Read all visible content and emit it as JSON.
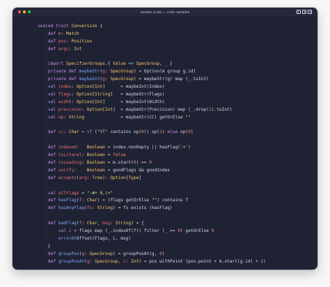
{
  "window": {
    "title": "sample.scala — code-samples"
  },
  "colors": {
    "background": "#1f2233",
    "keyword": "#c792ea",
    "type": "#ffcb6b",
    "function": "#82aaff",
    "variable": "#f07178",
    "operator": "#89ddff",
    "string": "#c3e88d",
    "number": "#f78c6c"
  },
  "icons": {
    "window_controls": [
      "close-dot-icon",
      "minimize-dot-icon",
      "zoom-dot-icon"
    ],
    "layout_tools": [
      "sidebar-layout-icon",
      "split-layout-icon",
      "right-panel-layout-icon"
    ]
  },
  "code": {
    "lines": [
      [
        {
          "t": "sealed ",
          "c": "k"
        },
        {
          "t": "trait ",
          "c": "k"
        },
        {
          "t": "Conversion",
          "c": "t"
        },
        {
          "t": " {",
          "c": "w"
        }
      ],
      [
        {
          "t": "    def ",
          "c": "k"
        },
        {
          "t": "m",
          "c": "v"
        },
        {
          "t": ": ",
          "c": "w"
        },
        {
          "t": "Match",
          "c": "t"
        }
      ],
      [
        {
          "t": "    def ",
          "c": "k"
        },
        {
          "t": "pos",
          "c": "v"
        },
        {
          "t": ": ",
          "c": "w"
        },
        {
          "t": "Position",
          "c": "t"
        }
      ],
      [
        {
          "t": "    def ",
          "c": "k"
        },
        {
          "t": "argc",
          "c": "v"
        },
        {
          "t": ": ",
          "c": "w"
        },
        {
          "t": "Int",
          "c": "t"
        }
      ],
      [
        {
          "t": "",
          "c": "w"
        }
      ],
      [
        {
          "t": "    import ",
          "c": "k"
        },
        {
          "t": "SpecifierGroups",
          "c": "t"
        },
        {
          "t": ".{ ",
          "c": "w"
        },
        {
          "t": "Value",
          "c": "t"
        },
        {
          "t": " => ",
          "c": "p"
        },
        {
          "t": "SpecGroup",
          "c": "t"
        },
        {
          "t": ", _ }",
          "c": "w"
        }
      ],
      [
        {
          "t": "    private ",
          "c": "k"
        },
        {
          "t": "def ",
          "c": "k"
        },
        {
          "t": "maybeStr",
          "c": "f"
        },
        {
          "t": "(",
          "c": "w"
        },
        {
          "t": "g",
          "c": "v"
        },
        {
          "t": ": ",
          "c": "w"
        },
        {
          "t": "SpecGroup",
          "c": "t"
        },
        {
          "t": ") = Option(m group g.id)",
          "c": "w"
        }
      ],
      [
        {
          "t": "    private ",
          "c": "k"
        },
        {
          "t": "def ",
          "c": "k"
        },
        {
          "t": "maybeInt",
          "c": "f"
        },
        {
          "t": "(",
          "c": "w"
        },
        {
          "t": "g",
          "c": "v"
        },
        {
          "t": ": ",
          "c": "w"
        },
        {
          "t": "SpecGroup",
          "c": "t"
        },
        {
          "t": ") = maybeStr(g) map (_.toInt)",
          "c": "w"
        }
      ],
      [
        {
          "t": "    val ",
          "c": "k"
        },
        {
          "t": "index",
          "c": "v"
        },
        {
          "t": ": ",
          "c": "w"
        },
        {
          "t": "Option",
          "c": "t"
        },
        {
          "t": "[",
          "c": "w"
        },
        {
          "t": "Int",
          "c": "t"
        },
        {
          "t": "]      = maybeInt(Index)",
          "c": "w"
        }
      ],
      [
        {
          "t": "    val ",
          "c": "k"
        },
        {
          "t": "flags",
          "c": "v"
        },
        {
          "t": ": ",
          "c": "w"
        },
        {
          "t": "Option",
          "c": "t"
        },
        {
          "t": "[",
          "c": "w"
        },
        {
          "t": "String",
          "c": "t"
        },
        {
          "t": "]   = maybeStr(Flags)",
          "c": "w"
        }
      ],
      [
        {
          "t": "    val ",
          "c": "k"
        },
        {
          "t": "width",
          "c": "v"
        },
        {
          "t": ": ",
          "c": "w"
        },
        {
          "t": "Option",
          "c": "t"
        },
        {
          "t": "[",
          "c": "w"
        },
        {
          "t": "Int",
          "c": "t"
        },
        {
          "t": "]      = maybeInt(Width)",
          "c": "w"
        }
      ],
      [
        {
          "t": "    val ",
          "c": "k"
        },
        {
          "t": "precision",
          "c": "v"
        },
        {
          "t": ": ",
          "c": "w"
        },
        {
          "t": "Option",
          "c": "t"
        },
        {
          "t": "[",
          "c": "w"
        },
        {
          "t": "Int",
          "c": "t"
        },
        {
          "t": "]  = maybeStr(Precision) map (_.drop(",
          "c": "w"
        },
        {
          "t": "1",
          "c": "n"
        },
        {
          "t": ").toInt)",
          "c": "w"
        }
      ],
      [
        {
          "t": "    val ",
          "c": "k"
        },
        {
          "t": "op",
          "c": "v"
        },
        {
          "t": ": ",
          "c": "w"
        },
        {
          "t": "String",
          "c": "t"
        },
        {
          "t": "              = maybeStr(CC) getOrElse ",
          "c": "w"
        },
        {
          "t": "\"\"",
          "c": "s"
        }
      ],
      [
        {
          "t": "",
          "c": "w"
        }
      ],
      [
        {
          "t": "    def ",
          "c": "k"
        },
        {
          "t": "cc",
          "c": "v"
        },
        {
          "t": ": ",
          "c": "w"
        },
        {
          "t": "Char",
          "c": "t"
        },
        {
          "t": " = ",
          "c": "p"
        },
        {
          "t": "if",
          "c": "k"
        },
        {
          "t": " (",
          "c": "w"
        },
        {
          "t": "\"tT\"",
          "c": "s"
        },
        {
          "t": " contains op(",
          "c": "w"
        },
        {
          "t": "0",
          "c": "n"
        },
        {
          "t": ")) op(",
          "c": "w"
        },
        {
          "t": "1",
          "c": "n"
        },
        {
          "t": ") ",
          "c": "w"
        },
        {
          "t": "else",
          "c": "k"
        },
        {
          "t": " op(",
          "c": "w"
        },
        {
          "t": "0",
          "c": "n"
        },
        {
          "t": ")",
          "c": "w"
        }
      ],
      [
        {
          "t": "",
          "c": "w"
        }
      ],
      [
        {
          "t": "    def ",
          "c": "k"
        },
        {
          "t": "indexed",
          "c": "v"
        },
        {
          "t": ":   ",
          "c": "w"
        },
        {
          "t": "Boolean",
          "c": "t"
        },
        {
          "t": " = index.nonEmpty || hasFlag(",
          "c": "w"
        },
        {
          "t": "'<'",
          "c": "s"
        },
        {
          "t": ")",
          "c": "w"
        }
      ],
      [
        {
          "t": "    def ",
          "c": "k"
        },
        {
          "t": "isLiteral",
          "c": "v"
        },
        {
          "t": ": ",
          "c": "w"
        },
        {
          "t": "Boolean",
          "c": "t"
        },
        {
          "t": " = ",
          "c": "w"
        },
        {
          "t": "false",
          "c": "n"
        }
      ],
      [
        {
          "t": "    def ",
          "c": "k"
        },
        {
          "t": "isLeading",
          "c": "v"
        },
        {
          "t": ": ",
          "c": "w"
        },
        {
          "t": "Boolean",
          "c": "t"
        },
        {
          "t": " = m.start(",
          "c": "w"
        },
        {
          "t": "0",
          "c": "n"
        },
        {
          "t": ") == ",
          "c": "w"
        },
        {
          "t": "0",
          "c": "n"
        }
      ],
      [
        {
          "t": "    def ",
          "c": "k"
        },
        {
          "t": "verify",
          "c": "v"
        },
        {
          "t": ":    ",
          "c": "w"
        },
        {
          "t": "Boolean",
          "c": "t"
        },
        {
          "t": " = goodFlags && goodIndex",
          "c": "w"
        }
      ],
      [
        {
          "t": "    def ",
          "c": "k"
        },
        {
          "t": "accepts",
          "c": "v"
        },
        {
          "t": "(",
          "c": "w"
        },
        {
          "t": "arg",
          "c": "v"
        },
        {
          "t": ": ",
          "c": "w"
        },
        {
          "t": "Tree",
          "c": "t"
        },
        {
          "t": "): ",
          "c": "w"
        },
        {
          "t": "Option",
          "c": "t"
        },
        {
          "t": "[",
          "c": "w"
        },
        {
          "t": "Type",
          "c": "t"
        },
        {
          "t": "]",
          "c": "w"
        }
      ],
      [
        {
          "t": "",
          "c": "w"
        }
      ],
      [
        {
          "t": "    val ",
          "c": "k"
        },
        {
          "t": "allFlags",
          "c": "v"
        },
        {
          "t": " = ",
          "c": "w"
        },
        {
          "t": "\"-#+ 0,(<\"",
          "c": "s"
        }
      ],
      [
        {
          "t": "    def ",
          "c": "k"
        },
        {
          "t": "hasFlag",
          "c": "f"
        },
        {
          "t": "(",
          "c": "w"
        },
        {
          "t": "f",
          "c": "v"
        },
        {
          "t": ": ",
          "c": "w"
        },
        {
          "t": "Char",
          "c": "t"
        },
        {
          "t": ") = (flags getOrElse ",
          "c": "w"
        },
        {
          "t": "\"\"",
          "c": "s"
        },
        {
          "t": ") contains f",
          "c": "w"
        }
      ],
      [
        {
          "t": "    def ",
          "c": "k"
        },
        {
          "t": "hasAnyFlag",
          "c": "f"
        },
        {
          "t": "(",
          "c": "w"
        },
        {
          "t": "fs",
          "c": "v"
        },
        {
          "t": ": ",
          "c": "w"
        },
        {
          "t": "String",
          "c": "t"
        },
        {
          "t": ") = fs exists (hasFlag)",
          "c": "w"
        }
      ],
      [
        {
          "t": "",
          "c": "w"
        }
      ],
      [
        {
          "t": "    def ",
          "c": "k"
        },
        {
          "t": "badFlag",
          "c": "f"
        },
        {
          "t": "(",
          "c": "w"
        },
        {
          "t": "f",
          "c": "v"
        },
        {
          "t": ": ",
          "c": "w"
        },
        {
          "t": "Char",
          "c": "t"
        },
        {
          "t": ", ",
          "c": "w"
        },
        {
          "t": "msg",
          "c": "v"
        },
        {
          "t": ": ",
          "c": "w"
        },
        {
          "t": "String",
          "c": "t"
        },
        {
          "t": ") = {",
          "c": "w"
        }
      ],
      [
        {
          "t": "        val ",
          "c": "k"
        },
        {
          "t": "i",
          "c": "v"
        },
        {
          "t": " = flags map (_.indexOf(f)) filter (_ >= ",
          "c": "w"
        },
        {
          "t": "0",
          "c": "n"
        },
        {
          "t": ") getOrElse ",
          "c": "w"
        },
        {
          "t": "0",
          "c": "n"
        }
      ],
      [
        {
          "t": "        errorAt",
          "c": "f"
        },
        {
          "t": "Offset(Flags, i, msg)",
          "c": "w"
        }
      ],
      [
        {
          "t": "    }",
          "c": "w"
        }
      ],
      [
        {
          "t": "    def ",
          "c": "k"
        },
        {
          "t": "groupPos",
          "c": "f"
        },
        {
          "t": "(",
          "c": "w"
        },
        {
          "t": "g",
          "c": "v"
        },
        {
          "t": ": ",
          "c": "w"
        },
        {
          "t": "SpecGroup",
          "c": "t"
        },
        {
          "t": ") = groupPosAt(g, ",
          "c": "w"
        },
        {
          "t": "0",
          "c": "n"
        },
        {
          "t": ")",
          "c": "w"
        }
      ],
      [
        {
          "t": "    def ",
          "c": "k"
        },
        {
          "t": "groupPosAt",
          "c": "f"
        },
        {
          "t": "(",
          "c": "w"
        },
        {
          "t": "g",
          "c": "v"
        },
        {
          "t": ": ",
          "c": "w"
        },
        {
          "t": "SpecGroup",
          "c": "t"
        },
        {
          "t": ", ",
          "c": "w"
        },
        {
          "t": "i",
          "c": "v"
        },
        {
          "t": ": ",
          "c": "w"
        },
        {
          "t": "Int",
          "c": "t"
        },
        {
          "t": ") = pos withPoint (pos.point + m.start(g.id) + i)",
          "c": "w"
        }
      ]
    ]
  }
}
